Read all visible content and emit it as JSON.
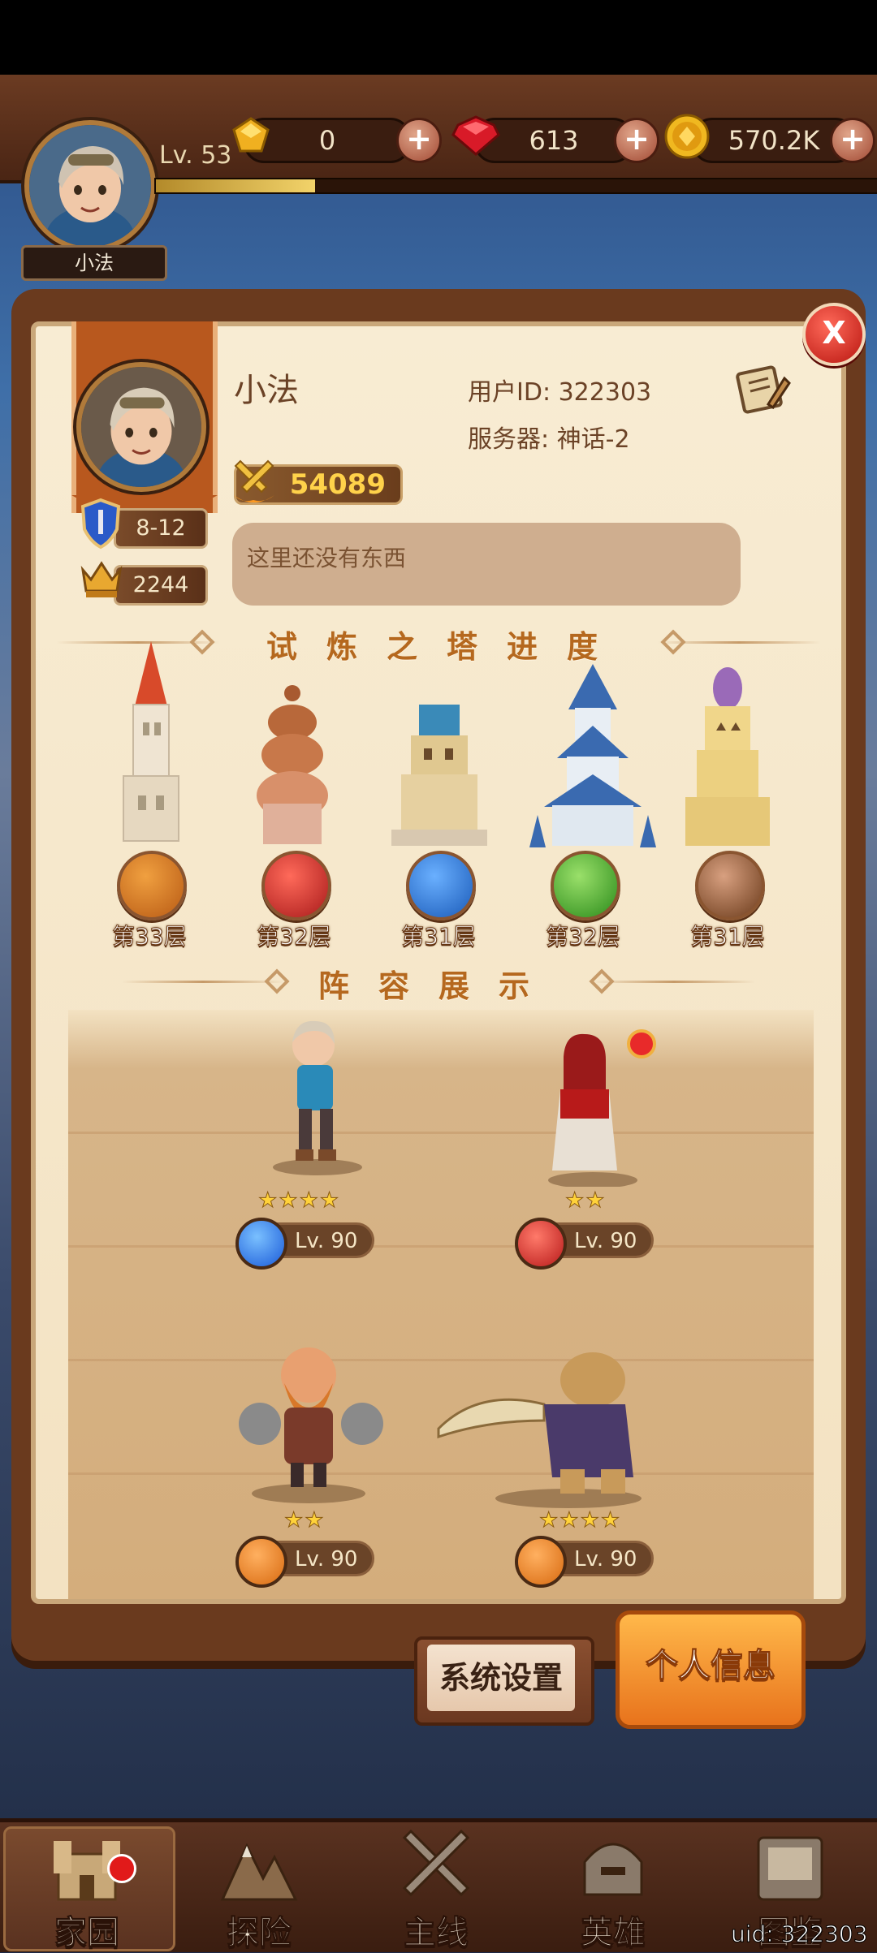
{
  "top": {
    "level": "Lv. 53",
    "player_name": "小法",
    "resources": [
      {
        "icon": "topaz-gem-icon",
        "value": "0"
      },
      {
        "icon": "ruby-gem-icon",
        "value": "613"
      },
      {
        "icon": "gold-coin-icon",
        "value": "570.2K"
      }
    ],
    "xp_progress": 0.22
  },
  "profile": {
    "nickname": "小法",
    "user_id": "用户ID: 322303",
    "server": "服务器: 神话-2",
    "power": "54089",
    "arena_rank": "8-12",
    "trophies": "2244",
    "bio": "这里还没有东西",
    "close_label": "X"
  },
  "tower_section": {
    "title": "试炼之塔进度",
    "towers": [
      {
        "name": "fire-tower",
        "floor": "第33层",
        "color": "#e07a2a"
      },
      {
        "name": "red-tower",
        "floor": "第32层",
        "color": "#c02a24"
      },
      {
        "name": "water-tower",
        "floor": "第31层",
        "color": "#2a7ad8"
      },
      {
        "name": "nature-tower",
        "floor": "第32层",
        "color": "#5ab02a"
      },
      {
        "name": "earth-tower",
        "floor": "第31层",
        "color": "#8a4a2a"
      }
    ]
  },
  "team_section": {
    "title": "阵容展示",
    "heroes": [
      {
        "name": "mage-boy-hero",
        "stars": "★★★★",
        "star_count": 4,
        "level": "Lv. 90",
        "element_color": "#2a6ae8"
      },
      {
        "name": "fire-priestess-hero",
        "stars": "★★",
        "star_count": 2,
        "level": "Lv. 90",
        "element_color": "#d8262a"
      },
      {
        "name": "dwarf-brawler-hero",
        "stars": "★★",
        "star_count": 2,
        "level": "Lv. 90",
        "element_color": "#e8821c"
      },
      {
        "name": "beast-warrior-hero",
        "stars": "★★★★",
        "star_count": 4,
        "level": "Lv. 90",
        "element_color": "#e8821c"
      }
    ]
  },
  "buttons": {
    "settings": "系统设置",
    "profile_info": "个人信息"
  },
  "nav": [
    {
      "label": "家园",
      "icon": "castle-icon"
    },
    {
      "label": "探险",
      "icon": "mountain-icon"
    },
    {
      "label": "主线",
      "icon": "crossed-swords-icon"
    },
    {
      "label": "英雄",
      "icon": "hero-helmet-icon"
    },
    {
      "label": "图鉴",
      "icon": "codex-icon"
    }
  ],
  "footer_uid": "uid: 322303",
  "colors": {
    "panel_bg": "#f3e2c2",
    "accent_orange": "#e8731c",
    "title_brown": "#b5681e"
  }
}
